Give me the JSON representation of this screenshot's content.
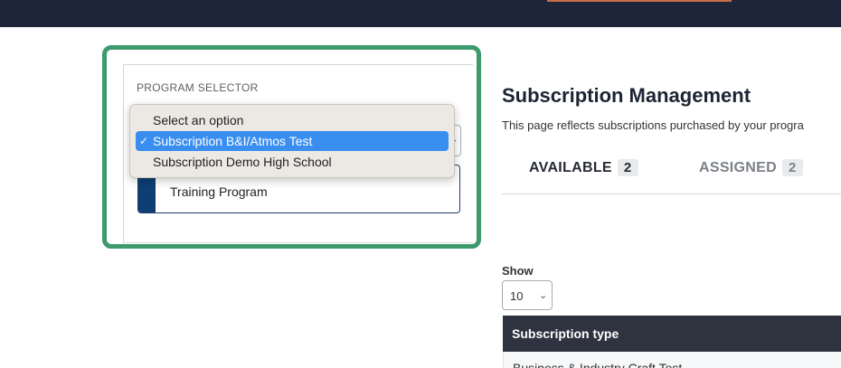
{
  "colors": {
    "topbar": "#1e2538",
    "accent": "#c96a4a",
    "highlight": "#3d9a6c",
    "selection": "#3a8ef0",
    "program_bar": "#0e3e73"
  },
  "program_selector": {
    "label": "PROGRAM SELECTOR",
    "dropdown_options": [
      {
        "label": "Select an option",
        "selected": false
      },
      {
        "label": "Subscription B&I/Atmos Test",
        "selected": true
      },
      {
        "label": "Subscription Demo High School",
        "selected": false
      }
    ],
    "program_card_text": "Training Program"
  },
  "main": {
    "title": "Subscription Management",
    "description": "This page reflects subscriptions purchased by your progra",
    "tabs": [
      {
        "label": "AVAILABLE",
        "count": "2"
      },
      {
        "label": "ASSIGNED",
        "count": "2"
      }
    ],
    "show_label": "Show",
    "page_length": "10",
    "table": {
      "header": "Subscription type",
      "first_row": "Business & Industry Craft Test"
    }
  }
}
